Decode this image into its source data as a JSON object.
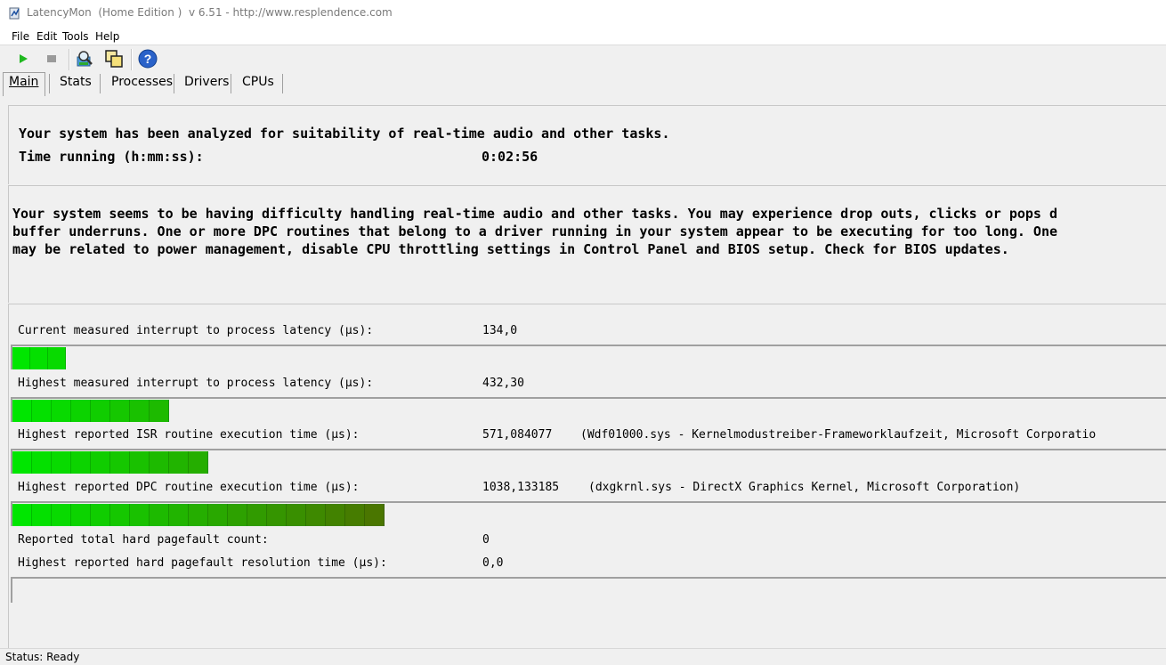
{
  "window": {
    "title": "LatencyMon  (Home Edition )  v 6.51 - http://www.resplendence.com"
  },
  "menu": [
    "File",
    "Edit",
    "Tools",
    "Help"
  ],
  "toolbar": {
    "buttons": [
      "play-icon",
      "stop-icon",
      "search-drivers-icon",
      "windows-icon",
      "help-icon"
    ]
  },
  "tabs": [
    "Main",
    "Stats",
    "Processes",
    "Drivers",
    "CPUs"
  ],
  "summary": {
    "line1": "Your system has been analyzed for suitability of real-time audio and other tasks.",
    "time_label": "Time running (h:mm:ss):",
    "time_value": "0:02:56"
  },
  "conclusion": {
    "line1": "Your system seems to be having difficulty handling real-time audio and other tasks. You may experience drop outs, clicks or pops d",
    "line2": "buffer underruns. One or more DPC routines that belong to a driver running in your system appear to be executing for too long. One",
    "line3": "may be related to power management, disable CPU throttling settings in Control Panel and BIOS setup. Check for BIOS updates."
  },
  "metrics": [
    {
      "label": "Current measured interrupt to process latency (µs):",
      "value": "134,0",
      "detail": "",
      "bar_segments": 3
    },
    {
      "label": "Highest measured interrupt to process latency (µs):",
      "value": "432,30",
      "detail": "",
      "bar_segments": 8
    },
    {
      "label": "Highest reported ISR routine execution time (µs):",
      "value": "571,084077",
      "detail": "(Wdf01000.sys - Kernelmodustreiber-Frameworklaufzeit, Microsoft Corporatio",
      "bar_segments": 10
    },
    {
      "label": "Highest reported DPC routine execution time (µs):",
      "value": "1038,133185",
      "detail": "(dxgkrnl.sys - DirectX Graphics Kernel, Microsoft Corporation)",
      "bar_segments": 19
    },
    {
      "label": "Reported total hard pagefault count:",
      "value": "0",
      "detail": ""
    },
    {
      "label": "Highest reported hard pagefault resolution time (µs):",
      "value": "0,0",
      "detail": "",
      "bar_segments": 0
    }
  ],
  "status": {
    "text": "Status: Ready"
  },
  "colors": {
    "bar_start": "#00e600",
    "bar_end": "#4f6e00"
  }
}
